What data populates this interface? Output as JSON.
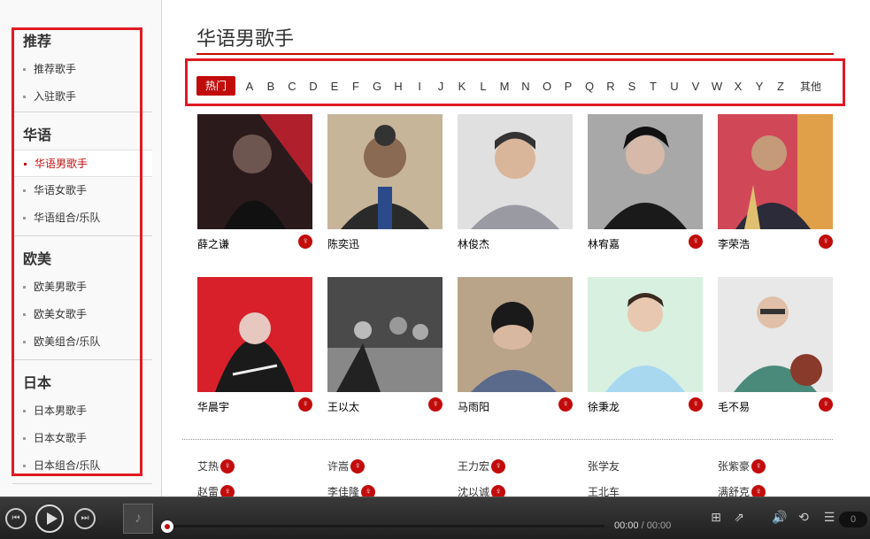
{
  "sidebar": {
    "groups": [
      {
        "title": "推荐",
        "items": [
          "推荐歌手",
          "入驻歌手"
        ]
      },
      {
        "title": "华语",
        "items": [
          "华语男歌手",
          "华语女歌手",
          "华语组合/乐队"
        ]
      },
      {
        "title": "欧美",
        "items": [
          "欧美男歌手",
          "欧美女歌手",
          "欧美组合/乐队"
        ]
      },
      {
        "title": "日本",
        "items": [
          "日本男歌手",
          "日本女歌手",
          "日本组合/乐队"
        ]
      }
    ],
    "active_item": "华语男歌手"
  },
  "main": {
    "title": "华语男歌手",
    "alpha": {
      "hot": "热门",
      "letters": [
        "A",
        "B",
        "C",
        "D",
        "E",
        "F",
        "G",
        "H",
        "I",
        "J",
        "K",
        "L",
        "M",
        "N",
        "O",
        "P",
        "Q",
        "R",
        "S",
        "T",
        "U",
        "V",
        "W",
        "X",
        "Y",
        "Z"
      ],
      "other": "其他"
    },
    "artists": [
      {
        "name": "薛之谦",
        "badge": true
      },
      {
        "name": "陈奕迅",
        "badge": false
      },
      {
        "name": "林俊杰",
        "badge": false
      },
      {
        "name": "林宥嘉",
        "badge": true
      },
      {
        "name": "李荣浩",
        "badge": true
      },
      {
        "name": "华晨宇",
        "badge": true
      },
      {
        "name": "王以太",
        "badge": true
      },
      {
        "name": "马雨阳",
        "badge": true
      },
      {
        "name": "徐秉龙",
        "badge": true
      },
      {
        "name": "毛不易",
        "badge": true
      }
    ],
    "name_rows": [
      [
        {
          "name": "艾热",
          "badge": true
        },
        {
          "name": "许嵩",
          "badge": true
        },
        {
          "name": "王力宏",
          "badge": true
        },
        {
          "name": "张学友",
          "badge": false
        },
        {
          "name": "张紫豪",
          "badge": true
        }
      ],
      [
        {
          "name": "赵雷",
          "badge": true
        },
        {
          "name": "李佳隆",
          "badge": true
        },
        {
          "name": "沈以诚",
          "badge": true
        },
        {
          "name": "王北车",
          "badge": false
        },
        {
          "name": "满舒克",
          "badge": true
        }
      ]
    ],
    "badge_glyph": "♀"
  },
  "player": {
    "time_current": "00:00",
    "time_total": "/ 00:00",
    "queue_count": "0"
  }
}
